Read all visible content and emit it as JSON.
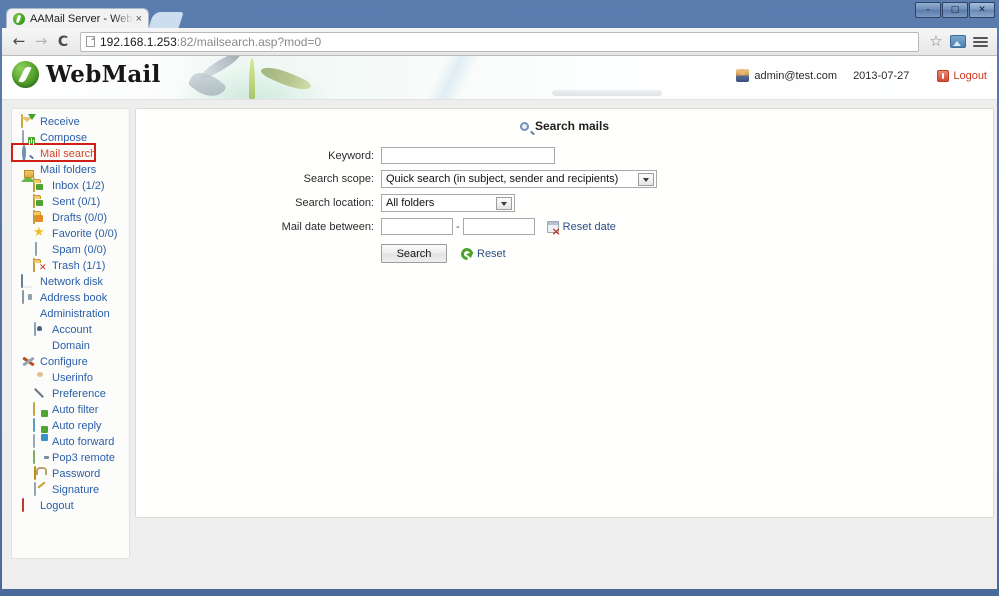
{
  "browser": {
    "tab": {
      "title": "AAMail Server - Webma",
      "favicon": "webmail-favicon",
      "close": "×"
    },
    "nav": {
      "back": "←",
      "forward": "→",
      "reload": "C"
    },
    "url": {
      "host": "192.168.1.253",
      "rest": ":82/mailsearch.asp?mod=0"
    },
    "toolbar_icons": {
      "star": "☆",
      "image": "image-icon",
      "menu": "hamburger-menu"
    },
    "window_controls": {
      "minimize": "–",
      "maximize": "□",
      "close": "✕"
    }
  },
  "header": {
    "logo_text": "WebMail",
    "user_email": "admin@test.com",
    "date": "2013-07-27",
    "logout": "Logout"
  },
  "sidebar": {
    "items": [
      {
        "label": "Receive",
        "icon": "receive-mail-icon",
        "level": 0,
        "active": false
      },
      {
        "label": "Compose",
        "icon": "compose-icon",
        "level": 0,
        "active": false
      },
      {
        "label": "Mail search",
        "icon": "search-icon",
        "level": 0,
        "active": true
      },
      {
        "label": "Mail folders",
        "icon": "home-folders-icon",
        "level": 0,
        "active": false
      },
      {
        "label": "Inbox (1/2)",
        "icon": "inbox-icon",
        "level": 1,
        "active": false
      },
      {
        "label": "Sent (0/1)",
        "icon": "sent-icon",
        "level": 1,
        "active": false
      },
      {
        "label": "Drafts (0/0)",
        "icon": "drafts-icon",
        "level": 1,
        "active": false
      },
      {
        "label": "Favorite (0/0)",
        "icon": "star-icon",
        "level": 1,
        "active": false
      },
      {
        "label": "Spam (0/0)",
        "icon": "spam-icon",
        "level": 1,
        "active": false
      },
      {
        "label": "Trash (1/1)",
        "icon": "trash-icon",
        "level": 1,
        "active": false
      },
      {
        "label": "Network disk",
        "icon": "disk-icon",
        "level": 0,
        "active": false
      },
      {
        "label": "Address book",
        "icon": "address-book-icon",
        "level": 0,
        "active": false
      },
      {
        "label": "Administration",
        "icon": "administration-icon",
        "level": 0,
        "active": false
      },
      {
        "label": "Account",
        "icon": "account-icon",
        "level": 1,
        "active": false
      },
      {
        "label": "Domain",
        "icon": "globe-icon",
        "level": 1,
        "active": false
      },
      {
        "label": "Configure",
        "icon": "tools-icon",
        "level": 0,
        "active": false
      },
      {
        "label": "Userinfo",
        "icon": "user-icon",
        "level": 1,
        "active": false
      },
      {
        "label": "Preference",
        "icon": "gear-icon",
        "level": 1,
        "active": false
      },
      {
        "label": "Auto filter",
        "icon": "auto-filter-icon",
        "level": 1,
        "active": false
      },
      {
        "label": "Auto reply",
        "icon": "auto-reply-icon",
        "level": 1,
        "active": false
      },
      {
        "label": "Auto forward",
        "icon": "auto-forward-icon",
        "level": 1,
        "active": false
      },
      {
        "label": "Pop3 remote",
        "icon": "plug-icon",
        "level": 1,
        "active": false
      },
      {
        "label": "Password",
        "icon": "lock-icon",
        "level": 1,
        "active": false
      },
      {
        "label": "Signature",
        "icon": "signature-icon",
        "level": 1,
        "active": false
      },
      {
        "label": "Logout",
        "icon": "power-icon",
        "level": 0,
        "active": false
      }
    ],
    "highlight": "mail-search"
  },
  "main": {
    "heading": "Search mails",
    "heading_icon": "search-icon",
    "form": {
      "keyword_label": "Keyword:",
      "keyword_value": "",
      "keyword_placeholder": "",
      "scope_label": "Search scope:",
      "scope_value": "Quick search (in subject, sender and recipients)",
      "location_label": "Search location:",
      "location_value": "All folders",
      "date_label": "Mail date between:",
      "date_from": "",
      "date_to": "",
      "date_separator": "-",
      "reset_date_label": "Reset date",
      "reset_date_icon": "calendar-delete-icon",
      "search_button": "Search",
      "reset_label": "Reset",
      "reset_icon": "refresh-icon"
    }
  },
  "colors": {
    "link": "#2b5ea8",
    "active": "#d4452d",
    "highlight_border": "#cf1f17",
    "logout": "#cc3b22",
    "window_frame": "#4a6a99"
  }
}
